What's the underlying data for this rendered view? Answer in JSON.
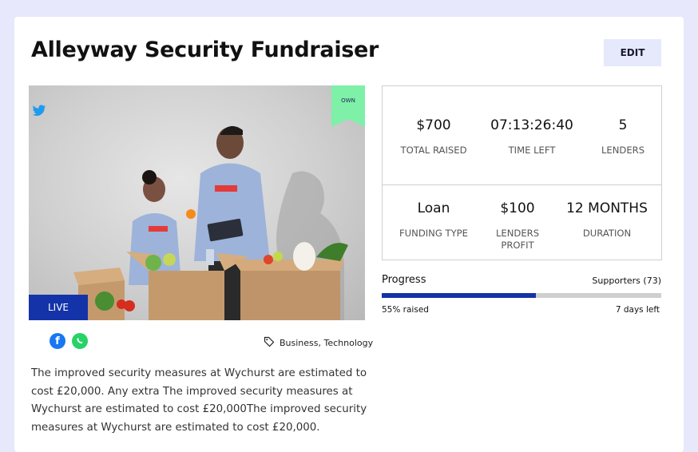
{
  "campaign": {
    "title": "Alleyway Security Fundraiser",
    "edit_label": "EDIT",
    "own_label": "OWN",
    "live_label": "LIVE",
    "tags": "Business, Technology",
    "description": "The improved security measures at Wychurst are estimated to cost £20,000. Any extra The improved security measures at Wychurst are estimated to cost £20,000The improved security measures at Wychurst are estimated to cost £20,000."
  },
  "stats": {
    "total_raised": {
      "value": "$700",
      "label": "TOTAL RAISED"
    },
    "time_left": {
      "value": "07:13:26:40",
      "label": "TIME LEFT"
    },
    "lenders": {
      "value": "5",
      "label": "LENDERS"
    },
    "funding_type": {
      "value": "Loan",
      "label": "FUNDING TYPE"
    },
    "lenders_profit": {
      "value": "$100",
      "label": "LENDERS PROFIT"
    },
    "duration": {
      "value": "12 MONTHS",
      "label": "DURATION"
    }
  },
  "progress": {
    "title": "Progress",
    "supporters": "Supporters (73)",
    "raised_text": "55% raised",
    "days_left": "7 days left",
    "fraction": 0.55
  },
  "icons": [
    "twitter-icon",
    "facebook-icon",
    "whatsapp-icon",
    "tag-icon"
  ],
  "colors": {
    "accent": "#1533a8",
    "own_ribbon": "#7ef0a8",
    "background": "#e7e8fb"
  }
}
